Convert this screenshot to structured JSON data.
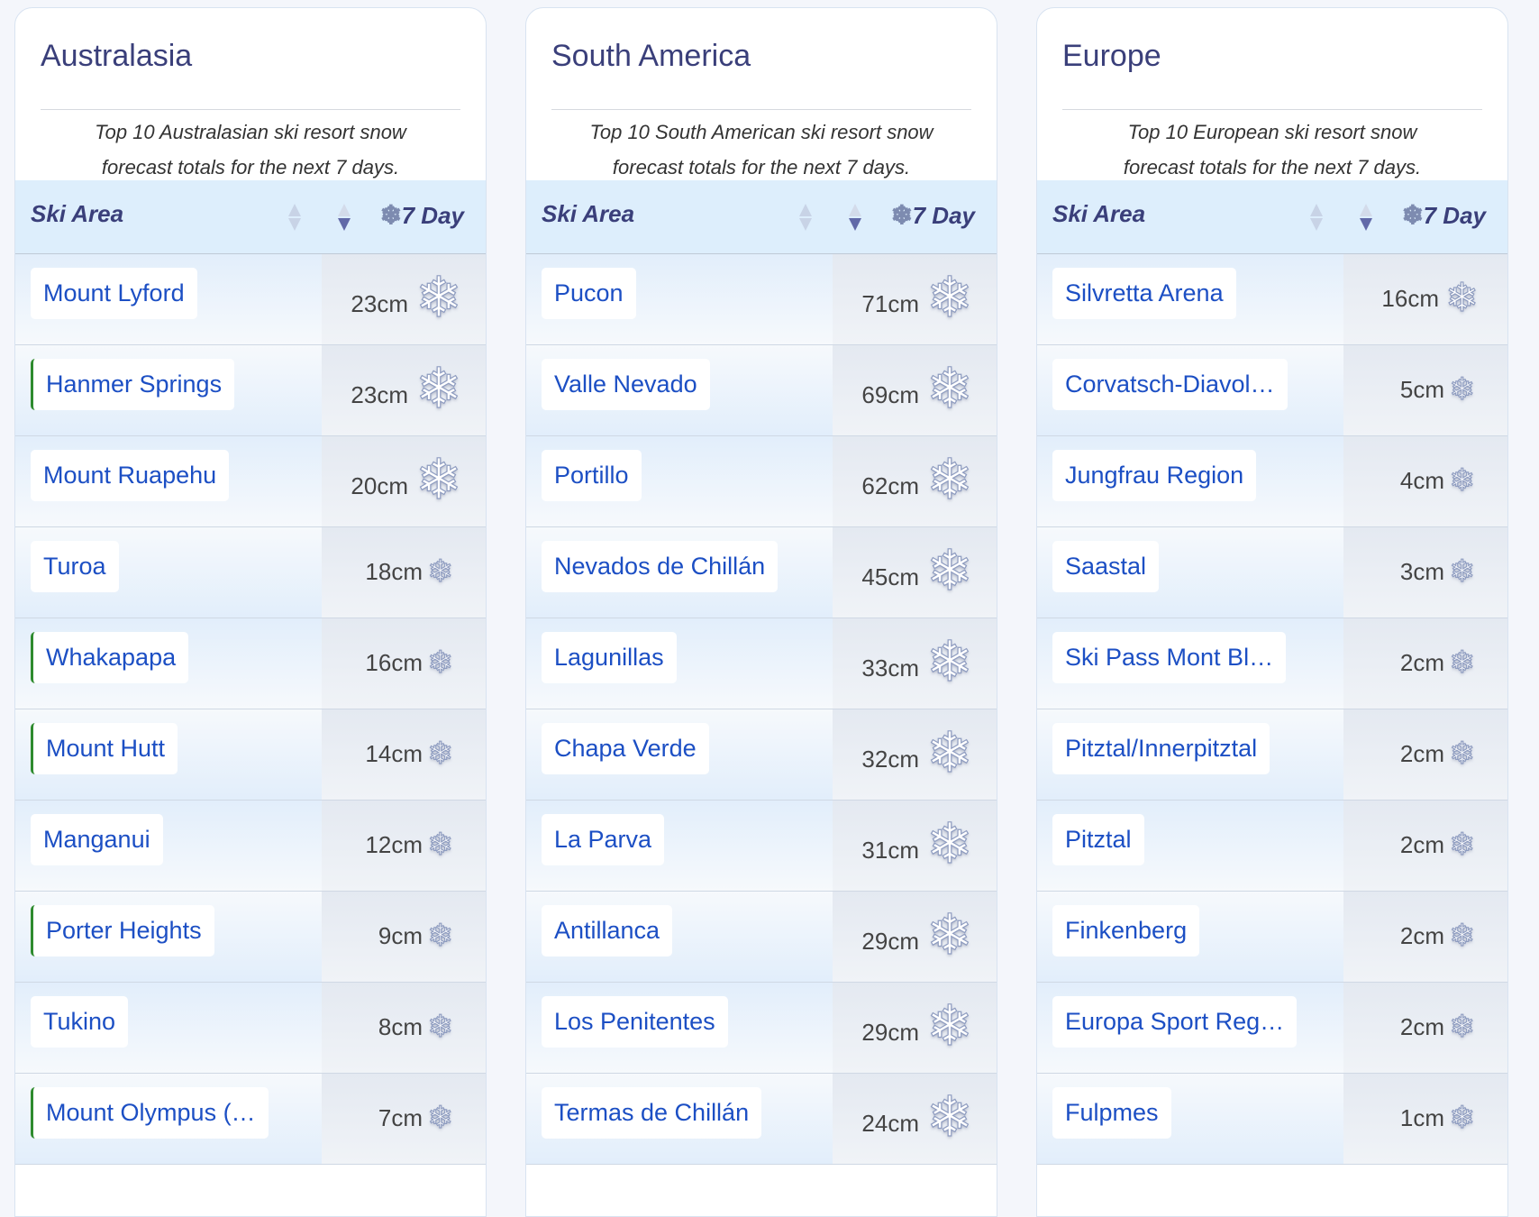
{
  "flake_glyph": "❄",
  "icons": {
    "snowflake": "snowflake-icon",
    "sort": "sort-arrows-icon"
  },
  "colors": {
    "link": "#1c4fc4",
    "title": "#3a3f7a",
    "header_bg": "#ddeefc",
    "marker": "#2e8b2e"
  },
  "panels": [
    {
      "title": "Australasia",
      "description": "Top 10 Australasian ski resort snow forecast totals for the next 7 days.",
      "col_ski": "Ski Area",
      "col_day": "7 Day",
      "rows": [
        {
          "name": "Mount Lyford",
          "amount": "23cm",
          "size": "big",
          "mark": false
        },
        {
          "name": "Hanmer Springs",
          "amount": "23cm",
          "size": "big",
          "mark": true
        },
        {
          "name": "Mount Ruapehu",
          "amount": "20cm",
          "size": "big",
          "mark": false
        },
        {
          "name": "Turoa",
          "amount": "18cm",
          "size": "small",
          "mark": false
        },
        {
          "name": "Whakapapa",
          "amount": "16cm",
          "size": "small",
          "mark": true
        },
        {
          "name": "Mount Hutt",
          "amount": "14cm",
          "size": "small",
          "mark": true
        },
        {
          "name": "Manganui",
          "amount": "12cm",
          "size": "small",
          "mark": false
        },
        {
          "name": "Porter Heights",
          "amount": "9cm",
          "size": "small",
          "mark": true
        },
        {
          "name": "Tukino",
          "amount": "8cm",
          "size": "small",
          "mark": false
        },
        {
          "name": "Mount Olympus (…",
          "amount": "7cm",
          "size": "small",
          "mark": true
        }
      ]
    },
    {
      "title": "South America",
      "description": "Top 10 South American ski resort snow forecast totals for the next 7 days.",
      "col_ski": "Ski Area",
      "col_day": "7 Day",
      "rows": [
        {
          "name": "Pucon",
          "amount": "71cm",
          "size": "big",
          "mark": false
        },
        {
          "name": "Valle Nevado",
          "amount": "69cm",
          "size": "big",
          "mark": false
        },
        {
          "name": "Portillo",
          "amount": "62cm",
          "size": "big",
          "mark": false
        },
        {
          "name": "Nevados de Chillán",
          "amount": "45cm",
          "size": "big",
          "mark": false
        },
        {
          "name": "Lagunillas",
          "amount": "33cm",
          "size": "big",
          "mark": false
        },
        {
          "name": "Chapa Verde",
          "amount": "32cm",
          "size": "big",
          "mark": false
        },
        {
          "name": "La Parva",
          "amount": "31cm",
          "size": "big",
          "mark": false
        },
        {
          "name": "Antillanca",
          "amount": "29cm",
          "size": "big",
          "mark": false
        },
        {
          "name": "Los Penitentes",
          "amount": "29cm",
          "size": "big",
          "mark": false
        },
        {
          "name": "Termas de Chillán",
          "amount": "24cm",
          "size": "big",
          "mark": false
        }
      ]
    },
    {
      "title": "Europe",
      "description": "Top 10 European ski resort snow forecast totals for the next 7 days.",
      "col_ski": "Ski Area",
      "col_day": "7 Day",
      "rows": [
        {
          "name": "Silvretta Arena",
          "amount": "16cm",
          "size": "mid",
          "mark": false
        },
        {
          "name": "Corvatsch-Diavol…",
          "amount": "5cm",
          "size": "small",
          "mark": false
        },
        {
          "name": "Jungfrau Region",
          "amount": "4cm",
          "size": "small",
          "mark": false
        },
        {
          "name": "Saastal",
          "amount": "3cm",
          "size": "small",
          "mark": false
        },
        {
          "name": "Ski Pass Mont Bl…",
          "amount": "2cm",
          "size": "small",
          "mark": false
        },
        {
          "name": "Pitztal/Innerpitztal",
          "amount": "2cm",
          "size": "small",
          "mark": false
        },
        {
          "name": "Pitztal",
          "amount": "2cm",
          "size": "small",
          "mark": false
        },
        {
          "name": "Finkenberg",
          "amount": "2cm",
          "size": "small",
          "mark": false
        },
        {
          "name": "Europa Sport Reg…",
          "amount": "2cm",
          "size": "small",
          "mark": false
        },
        {
          "name": "Fulpmes",
          "amount": "1cm",
          "size": "small",
          "mark": false
        }
      ]
    }
  ]
}
